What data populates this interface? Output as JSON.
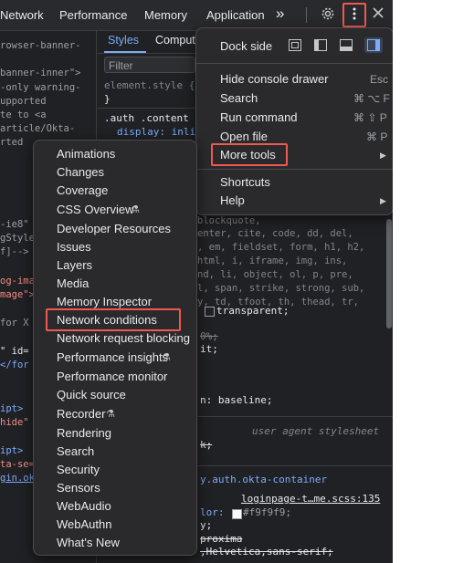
{
  "tabs": {
    "network": "Network",
    "performance": "Performance",
    "memory": "Memory",
    "application": "Application",
    "overflow": "»"
  },
  "icons": {
    "overflow": "chevron-double-right-icon",
    "settings": "gear-icon",
    "kebab": "vertical-dots-icon",
    "close": "close-icon"
  },
  "left_code": [
    "rowser-banner-",
    "",
    "banner-inner\">",
    "-only warning-",
    "upported",
    "te to <a",
    "article/Okta-",
    "rted",
    "-ie8\"",
    "gStyle",
    "f]-->",
    "og-ima",
    "mage\">",
    " for X",
    "\" id=",
    " </for",
    "ipt>",
    "hide\"",
    "ipt>",
    "ta-se=",
    "gin.ok"
  ],
  "styles_panel": {
    "tab_styles": "Styles",
    "tab_computed": "Comput",
    "filter_placeholder": "Filter",
    "element_style": "element.style {",
    "close_brace": "}",
    "rule_selector": ".auth .content",
    "display_prop": "display: inli",
    "ua_lines": [
      "blockquote,",
      "enter, cite, code, dd, del,",
      ", em, fieldset, form, h1, h2,",
      "html, i, iframe, img, ins,",
      "nd, li, object, ol, p, pre,",
      "l, span, strike, strong, sub,",
      "y, td, tfoot, th, thead, tr,"
    ],
    "transparent": "transparent;",
    "percent": "0%;",
    "inherit": "it;",
    "baseline_prop": "n: baseline;",
    "ua_label": "user agent stylesheet",
    "k_line": "k;",
    "okta_selector": "y.auth.okta-container",
    "source_link": "loginpage-t…me.scss:135",
    "color_label": "lor:",
    "color_value": "#f9f9f9;",
    "semi": "y;",
    "font1": "proxima",
    "font2": ",Helvetica,sans-serif;"
  },
  "main_menu": {
    "dock_side": "Dock side",
    "items": [
      {
        "label": "Hide console drawer",
        "shortcut": "Esc"
      },
      {
        "label": "Search",
        "shortcut": "⌘ ⌥ F"
      },
      {
        "label": "Run command",
        "shortcut": "⌘ ⇧ P"
      },
      {
        "label": "Open file",
        "shortcut": "⌘ P"
      },
      {
        "label": "More tools",
        "shortcut": ""
      },
      {
        "label": "Shortcuts",
        "shortcut": ""
      },
      {
        "label": "Help",
        "shortcut": ""
      }
    ]
  },
  "more_tools": {
    "items": [
      "Animations",
      "Changes",
      "Coverage",
      "CSS Overview",
      "Developer Resources",
      "Issues",
      "Layers",
      "Media",
      "Memory Inspector",
      "Network conditions",
      "Network request blocking",
      "Performance insights",
      "Performance monitor",
      "Quick source",
      "Recorder",
      "Rendering",
      "Search",
      "Security",
      "Sensors",
      "WebAudio",
      "WebAuthn",
      "What's New"
    ],
    "experimental_icon": "flask-icon"
  },
  "colors": {
    "highlight": "#ee5a52",
    "panel_bg": "#202124",
    "menu_bg": "#2a2a2d",
    "active_dock": "#7cacf8"
  }
}
